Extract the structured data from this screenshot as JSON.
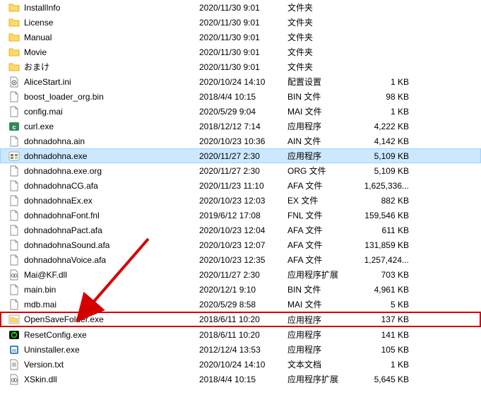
{
  "files": [
    {
      "name": "InstallInfo",
      "date": "2020/11/30 9:01",
      "type": "文件夹",
      "size": "",
      "icon": "folder"
    },
    {
      "name": "License",
      "date": "2020/11/30 9:01",
      "type": "文件夹",
      "size": "",
      "icon": "folder"
    },
    {
      "name": "Manual",
      "date": "2020/11/30 9:01",
      "type": "文件夹",
      "size": "",
      "icon": "folder"
    },
    {
      "name": "Movie",
      "date": "2020/11/30 9:01",
      "type": "文件夹",
      "size": "",
      "icon": "folder"
    },
    {
      "name": "おまけ",
      "date": "2020/11/30 9:01",
      "type": "文件夹",
      "size": "",
      "icon": "folder"
    },
    {
      "name": "AliceStart.ini",
      "date": "2020/10/24 14:10",
      "type": "配置设置",
      "size": "1 KB",
      "icon": "ini"
    },
    {
      "name": "boost_loader_org.bin",
      "date": "2018/4/4 10:15",
      "type": "BIN 文件",
      "size": "98 KB",
      "icon": "file"
    },
    {
      "name": "config.mai",
      "date": "2020/5/29 9:04",
      "type": "MAI 文件",
      "size": "1 KB",
      "icon": "file"
    },
    {
      "name": "curl.exe",
      "date": "2018/12/12 7:14",
      "type": "应用程序",
      "size": "4,222 KB",
      "icon": "exe-curl"
    },
    {
      "name": "dohnadohna.ain",
      "date": "2020/10/23 10:36",
      "type": "AIN 文件",
      "size": "4,142 KB",
      "icon": "file"
    },
    {
      "name": "dohnadohna.exe",
      "date": "2020/11/27 2:30",
      "type": "应用程序",
      "size": "5,109 KB",
      "icon": "exe-game",
      "selected": true
    },
    {
      "name": "dohnadohna.exe.org",
      "date": "2020/11/27 2:30",
      "type": "ORG 文件",
      "size": "5,109 KB",
      "icon": "file"
    },
    {
      "name": "dohnadohnaCG.afa",
      "date": "2020/11/23 11:10",
      "type": "AFA 文件",
      "size": "1,625,336...",
      "icon": "file"
    },
    {
      "name": "dohnadohnaEx.ex",
      "date": "2020/10/23 12:03",
      "type": "EX 文件",
      "size": "882 KB",
      "icon": "file"
    },
    {
      "name": "dohnadohnaFont.fnl",
      "date": "2019/6/12 17:08",
      "type": "FNL 文件",
      "size": "159,546 KB",
      "icon": "file"
    },
    {
      "name": "dohnadohnaPact.afa",
      "date": "2020/10/23 12:04",
      "type": "AFA 文件",
      "size": "611 KB",
      "icon": "file"
    },
    {
      "name": "dohnadohnaSound.afa",
      "date": "2020/10/23 12:07",
      "type": "AFA 文件",
      "size": "131,859 KB",
      "icon": "file"
    },
    {
      "name": "dohnadohnaVoice.afa",
      "date": "2020/10/23 12:35",
      "type": "AFA 文件",
      "size": "1,257,424...",
      "icon": "file"
    },
    {
      "name": "Mai@KF.dll",
      "date": "2020/11/27 2:30",
      "type": "应用程序扩展",
      "size": "703 KB",
      "icon": "dll"
    },
    {
      "name": "main.bin",
      "date": "2020/12/1 9:10",
      "type": "BIN 文件",
      "size": "4,961 KB",
      "icon": "file"
    },
    {
      "name": "mdb.mai",
      "date": "2020/5/29 8:58",
      "type": "MAI 文件",
      "size": "5 KB",
      "icon": "file"
    },
    {
      "name": "OpenSaveFolder.exe",
      "date": "2018/6/11 10:20",
      "type": "应用程序",
      "size": "137 KB",
      "icon": "exe-folder",
      "highlighted": true
    },
    {
      "name": "ResetConfig.exe",
      "date": "2018/6/11 10:20",
      "type": "应用程序",
      "size": "141 KB",
      "icon": "exe-reset"
    },
    {
      "name": "Uninstaller.exe",
      "date": "2012/12/4 13:53",
      "type": "应用程序",
      "size": "105 KB",
      "icon": "exe-uninstall"
    },
    {
      "name": "Version.txt",
      "date": "2020/10/24 14:10",
      "type": "文本文档",
      "size": "1 KB",
      "icon": "txt"
    },
    {
      "name": "XSkin.dll",
      "date": "2018/4/4 10:15",
      "type": "应用程序扩展",
      "size": "5,645 KB",
      "icon": "dll"
    }
  ],
  "annotation": {
    "arrow_color": "#d40000"
  }
}
